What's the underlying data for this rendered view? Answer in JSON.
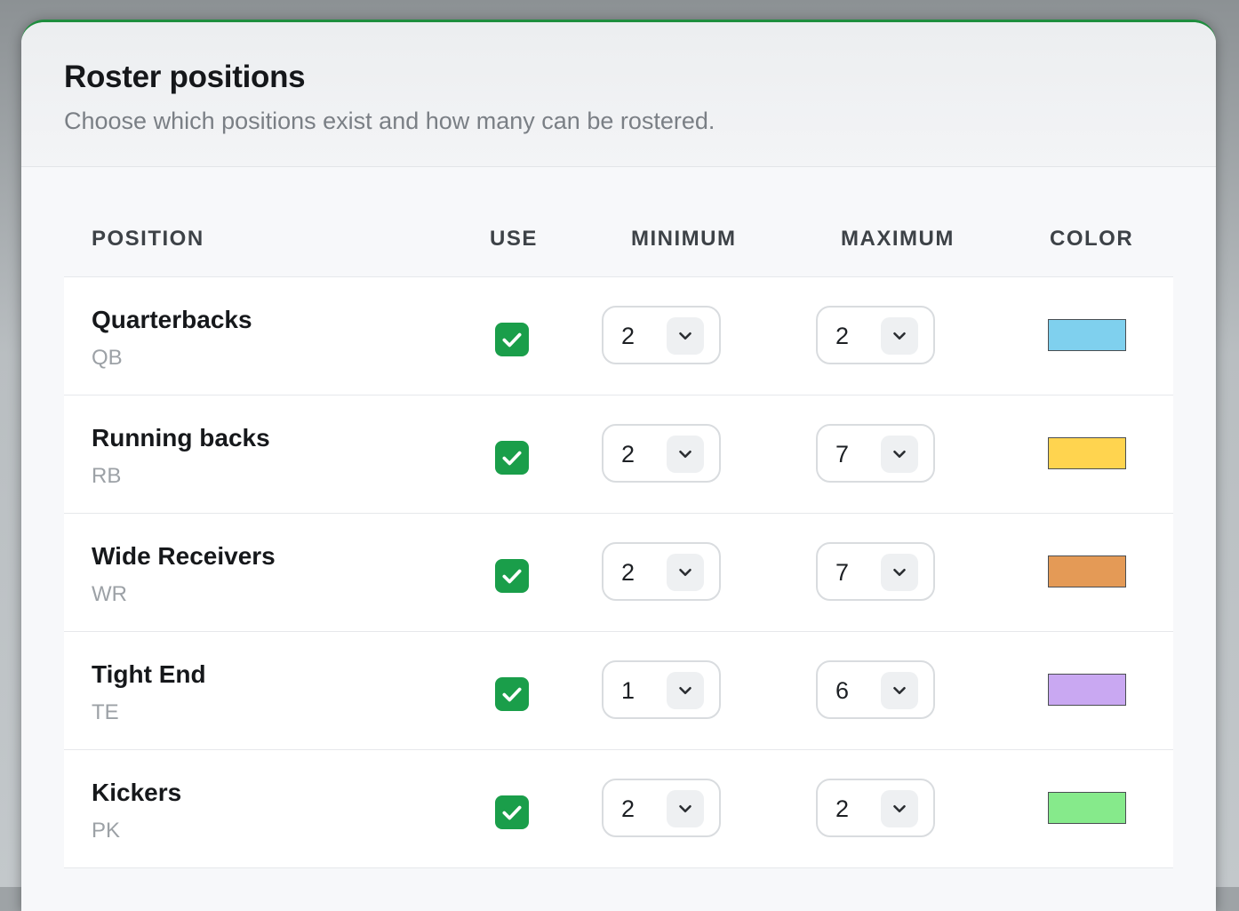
{
  "header": {
    "title": "Roster positions",
    "subtitle": "Choose which positions exist and how many can be rostered."
  },
  "table": {
    "columns": {
      "position": "POSITION",
      "use": "USE",
      "minimum": "MINIMUM",
      "maximum": "MAXIMUM",
      "color": "COLOR"
    },
    "rows": [
      {
        "name": "Quarterbacks",
        "abbr": "QB",
        "use": true,
        "minimum": "2",
        "maximum": "2",
        "color": "#7fd0ee"
      },
      {
        "name": "Running backs",
        "abbr": "RB",
        "use": true,
        "minimum": "2",
        "maximum": "7",
        "color": "#ffd44f"
      },
      {
        "name": "Wide Receivers",
        "abbr": "WR",
        "use": true,
        "minimum": "2",
        "maximum": "7",
        "color": "#e49a56"
      },
      {
        "name": "Tight End",
        "abbr": "TE",
        "use": true,
        "minimum": "1",
        "maximum": "6",
        "color": "#c9a8f2"
      },
      {
        "name": "Kickers",
        "abbr": "PK",
        "use": true,
        "minimum": "2",
        "maximum": "2",
        "color": "#86ea8b"
      }
    ]
  },
  "icons": {
    "checkbox": "check-icon",
    "select": "chevron-down-icon"
  },
  "theme": {
    "accent": "#1e8e3e",
    "checkbox_color": "#1a9e4a"
  }
}
